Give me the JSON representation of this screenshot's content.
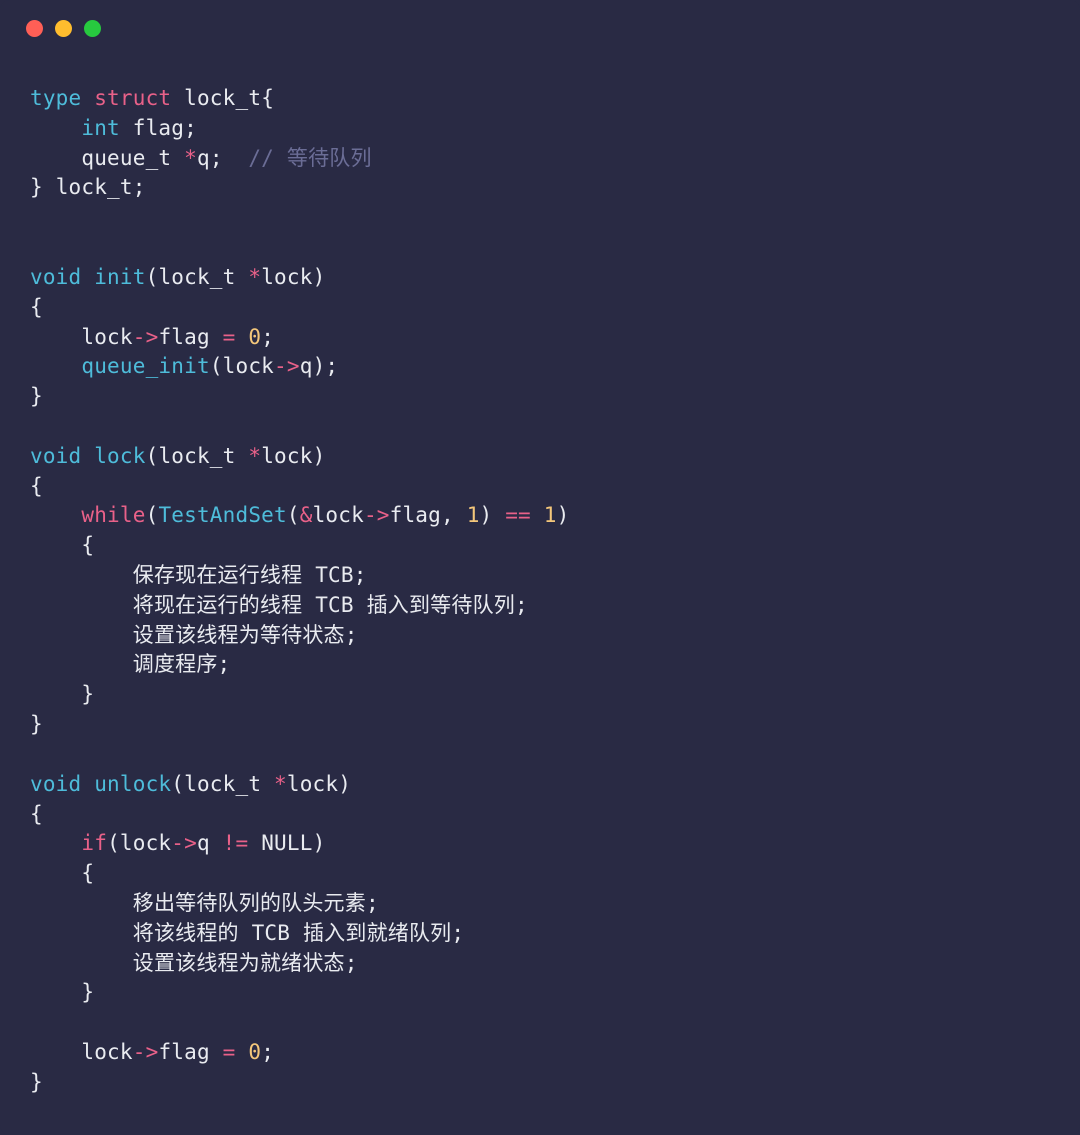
{
  "window": {
    "dots": {
      "red": "#ff5f56",
      "yellow": "#ffbd2e",
      "green": "#27c93f"
    }
  },
  "code": {
    "l01_type": "type",
    "l01_struct": "struct",
    "l01_name": "lock_t",
    "l01_brace": "{",
    "l02_int": "int",
    "l02_flag": "flag",
    "l02_semi": ";",
    "l03_queue_t": "queue_t",
    "l03_star": "*",
    "l03_q": "q",
    "l03_semi": ";",
    "l03_cmt": "// 等待队列",
    "l04_brace": "}",
    "l04_name": "lock_t",
    "l04_semi": ";",
    "l07_void": "void",
    "l07_fn": "init",
    "l07_lp": "(",
    "l07_type": "lock_t",
    "l07_star": "*",
    "l07_param": "lock",
    "l07_rp": ")",
    "l08_brace": "{",
    "l09_lock": "lock",
    "l09_arrow": "->",
    "l09_flag": "flag",
    "l09_eq": "=",
    "l09_zero": "0",
    "l09_semi": ";",
    "l10_fn": "queue_init",
    "l10_lp": "(",
    "l10_lock": "lock",
    "l10_arrow": "->",
    "l10_q": "q",
    "l10_rp": ")",
    "l10_semi": ";",
    "l11_brace": "}",
    "l13_void": "void",
    "l13_fn": "lock",
    "l13_lp": "(",
    "l13_type": "lock_t",
    "l13_star": "*",
    "l13_param": "lock",
    "l13_rp": ")",
    "l14_brace": "{",
    "l15_while": "while",
    "l15_lp": "(",
    "l15_fn": "TestAndSet",
    "l15_lp2": "(",
    "l15_amp": "&",
    "l15_lock": "lock",
    "l15_arrow": "->",
    "l15_flag": "flag",
    "l15_comma": ",",
    "l15_one": "1",
    "l15_rp2": ")",
    "l15_eqeq": "==",
    "l15_one2": "1",
    "l15_rp": ")",
    "l16_brace": "{",
    "l17": "保存现在运行线程 TCB;",
    "l18": "将现在运行的线程 TCB 插入到等待队列;",
    "l19": "设置该线程为等待状态;",
    "l20": "调度程序;",
    "l21_brace": "}",
    "l22_brace": "}",
    "l24_void": "void",
    "l24_fn": "unlock",
    "l24_lp": "(",
    "l24_type": "lock_t",
    "l24_star": "*",
    "l24_param": "lock",
    "l24_rp": ")",
    "l25_brace": "{",
    "l26_if": "if",
    "l26_lp": "(",
    "l26_lock": "lock",
    "l26_arrow": "->",
    "l26_q": "q",
    "l26_neq": "!=",
    "l26_null": "NULL",
    "l26_rp": ")",
    "l27_brace": "{",
    "l28": "移出等待队列的队头元素;",
    "l29": "将该线程的 TCB 插入到就绪队列;",
    "l30": "设置该线程为就绪状态;",
    "l31_brace": "}",
    "l33_lock": "lock",
    "l33_arrow": "->",
    "l33_flag": "flag",
    "l33_eq": "=",
    "l33_zero": "0",
    "l33_semi": ";",
    "l34_brace": "}"
  }
}
